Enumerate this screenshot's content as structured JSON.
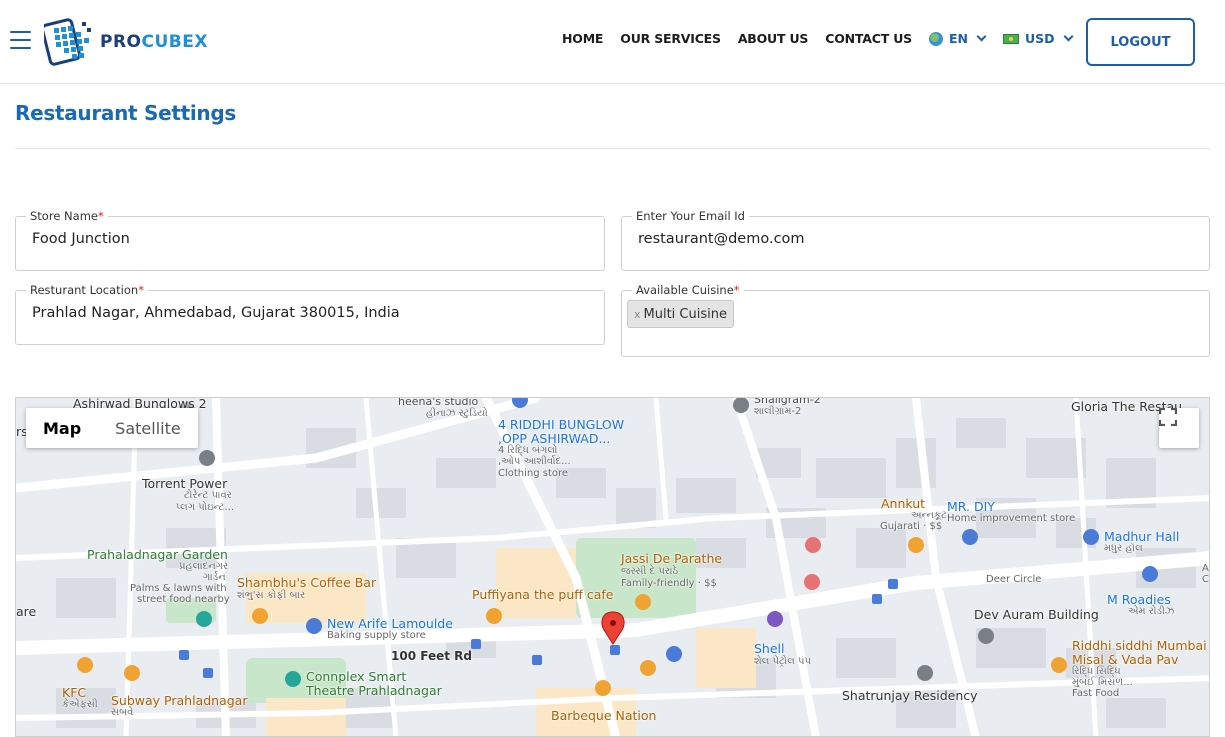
{
  "header": {
    "logo_pro": "PRO",
    "logo_cubex": "CUBEX",
    "nav": [
      "HOME",
      "OUR SERVICES",
      "ABOUT US",
      "CONTACT US"
    ],
    "language": "EN",
    "currency": "USD",
    "logout_label": "LOGOUT"
  },
  "page": {
    "title": "Restaurant Settings"
  },
  "form": {
    "store_name": {
      "label": "Store Name",
      "required": "*",
      "value": "Food Junction"
    },
    "email": {
      "label": "Enter Your Email Id",
      "value": "restaurant@demo.com"
    },
    "location": {
      "label": "Resturant Location",
      "required": "*",
      "value": "Prahlad Nagar, Ahmedabad, Gujarat 380015, India"
    },
    "cuisine": {
      "label": "Available Cuisine",
      "required": "*",
      "remove": "x",
      "tag": "Multi Cuisine"
    }
  },
  "map": {
    "type_map": "Map",
    "type_satellite": "Satellite",
    "labels": {
      "ashirwad": "Ashirwad Bunglows 2",
      "heenas": "heena's studio",
      "heenas_sub": "હીનાઝ સ્ટુડિયો",
      "riddhi_bunglow1": "4 RIDDHI BUNGLOW",
      "riddhi_bunglow2": ",OPP ASHIRWAD...",
      "riddhi_sub1": "4 રિદ્ધિ બંગલો",
      "riddhi_sub2": ",ઓપ આશીર્વાદ...",
      "clothing": "Clothing store",
      "shaligram": "Shaligram-2",
      "shaligram_sub": "શાલીગ્રામ-2",
      "gloria": "Gloria The Restau",
      "torrent": "Torrent Power",
      "torrent_sub1": "ટોરેન્ટ પાવર",
      "torrent_sub2": "પ્લગ પોઇન્ટ...",
      "annkut": "Annkut",
      "annkut_sub1": "અન્નકૂટ",
      "annkut_sub2": "Gujarati · $$",
      "mrdiy": "MR. DIY",
      "mrdiy_sub": "Home improvement store",
      "madhur": "Madhur Hall",
      "madhur_sub": "મધુર હૉલ",
      "garden": "Prahaladnagar Garden",
      "garden_sub1": "પ્રહલાદનગર",
      "garden_sub2": "ગાર્ડન",
      "garden_sub3": "Palms & lawns with",
      "garden_sub4": "street food nearby",
      "jassi": "Jassi De Parathe",
      "jassi_sub1": "જસ્સી દે પરાઠે",
      "jassi_sub2": "Family-friendly · $$",
      "deer": "Deer Circle",
      "shambhu": "Shambhu's Coffee Bar",
      "shambhu_sub": "શંભુ'સ કોફી બાર",
      "puffiyana": "Puffiyana the puff cafe",
      "dev": "Dev Auram Building",
      "mroadies": "M Roadies",
      "mroadies_sub": "એમ રોડીઝ",
      "arife": "New Arife Lamoulde",
      "arife_sub": "Baking supply store",
      "shell": "Shell",
      "shell_sub": "શેલ પેટ્રોલ પંપ",
      "riddhi_misal1": "Riddhi siddhi Mumbai",
      "riddhi_misal2": "Misal & Vada Pav",
      "riddhi_misal3": "રિદ્ધિ સિદ્ધિ",
      "riddhi_misal4": "મુંબઈ મિસળ...",
      "riddhi_misal5": "Fast Food",
      "feet": "100 Feet Rd",
      "connplex1": "Connplex Smart",
      "connplex2": "Theatre Prahladnagar",
      "shatrunjay": "Shatrunjay Residency",
      "kfc": "KFC",
      "kfc_sub": "કેએફસી",
      "subway": "Subway Prahladnagar",
      "subway_sub": "સબવે",
      "barbeque": "Barbeque Nation",
      "rs": "rs",
      "are": "are",
      "anar": "Anar",
      "cro": "Cro"
    }
  }
}
